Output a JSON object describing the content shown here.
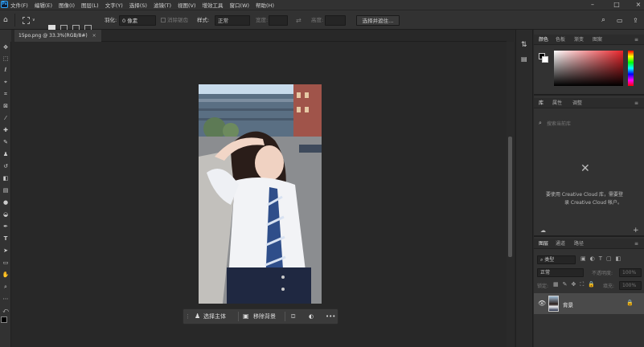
{
  "app": {
    "logo": "Ps"
  },
  "menu": [
    "文件(F)",
    "编辑(E)",
    "图像(I)",
    "图层(L)",
    "文字(Y)",
    "选择(S)",
    "滤镜(T)",
    "视图(V)",
    "增效工具",
    "窗口(W)",
    "帮助(H)"
  ],
  "options": {
    "feather_label": "羽化:",
    "feather_value": "0 像素",
    "antialias": "消除锯齿",
    "style_label": "样式:",
    "style_value": "正常",
    "width_label": "宽度:",
    "height_label": "高度:",
    "select_mask": "选择并遮住..."
  },
  "document": {
    "tab_title": "15po.png @ 33.3%(RGB/8#)",
    "close": "×"
  },
  "context_bar": {
    "select_subject": "选择主体",
    "remove_bg": "移除背景",
    "more": "•••"
  },
  "panels": {
    "color_tabs": [
      "颜色",
      "色板",
      "渐变",
      "图案"
    ],
    "library_tabs": [
      "库",
      "属性",
      "调整"
    ],
    "library_search": "搜索当前库",
    "library_message_line1": "要使用 Creative Cloud 库，需要登",
    "library_message_line2": "录 Creative Cloud 帐户。",
    "layers_tabs": [
      "图层",
      "通道",
      "路径"
    ],
    "layers_filter": "类型",
    "blend_mode": "正常",
    "opacity_label": "不透明度:",
    "opacity_value": "100%",
    "lock_label": "锁定:",
    "fill_label": "填充:",
    "fill_value": "100%",
    "layer_name": "背景"
  },
  "colors": {
    "accent": "#31a8ff",
    "panel_bg": "#323232",
    "canvas_bg": "#282828"
  }
}
